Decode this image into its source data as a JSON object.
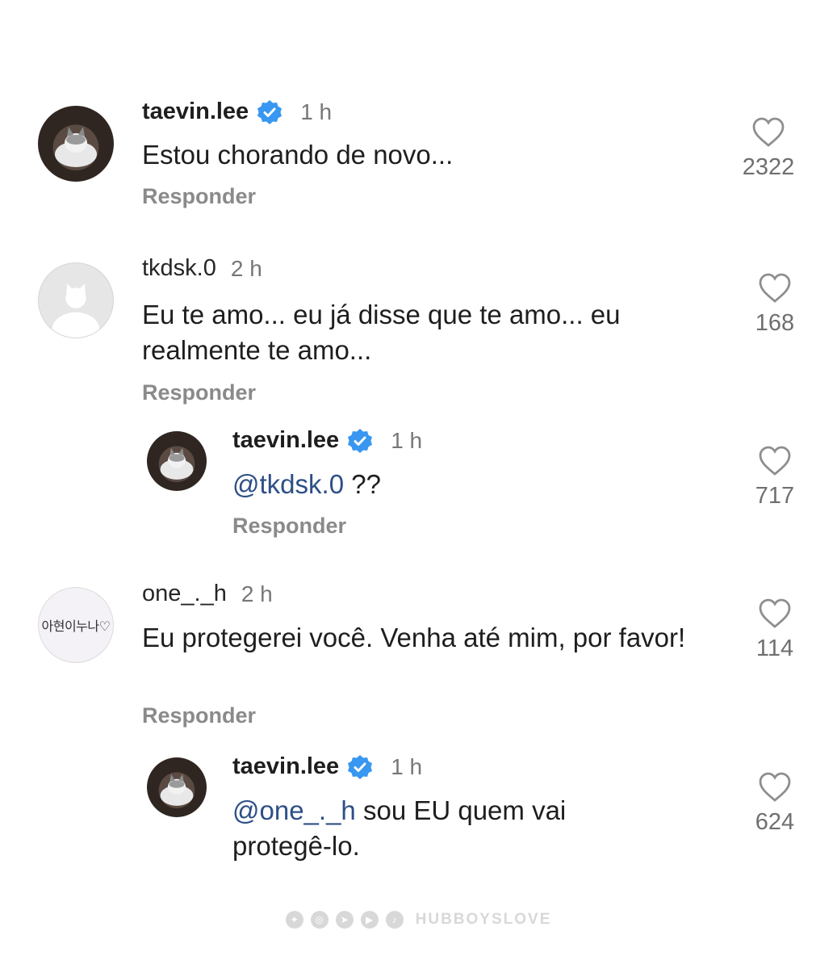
{
  "comments": [
    {
      "username": "taevin.lee",
      "verified": true,
      "time": "1 h",
      "text": "Estou chorando de novo...",
      "reply_label": "Responder",
      "likes": "2322",
      "avatar": "cat-photo"
    },
    {
      "username": "tkdsk.0",
      "verified": false,
      "time": "2 h",
      "text": "Eu te amo... eu já disse que te amo... eu realmente te amo...",
      "reply_label": "Responder",
      "likes": "168",
      "avatar": "default-cat-silhouette",
      "replies": [
        {
          "username": "taevin.lee",
          "verified": true,
          "time": "1 h",
          "mention": "@tkdsk.0",
          "text": " ??",
          "reply_label": "Responder",
          "likes": "717",
          "avatar": "cat-photo"
        }
      ]
    },
    {
      "username": "one_._h",
      "verified": false,
      "time": "2 h",
      "text": "Eu protegerei você. Venha até mim, por favor!",
      "reply_label": "Responder",
      "likes": "114",
      "avatar_text": "아현이누나♡",
      "replies": [
        {
          "username": "taevin.lee",
          "verified": true,
          "time": "1 h",
          "mention": "@one_._h",
          "text": " sou EU quem vai protegê-lo.",
          "likes": "624",
          "avatar": "cat-photo"
        }
      ]
    }
  ],
  "watermark": {
    "text": "HUBBOYSLOVE",
    "icons": [
      "twitter-icon",
      "instagram-icon",
      "telegram-icon",
      "youtube-icon",
      "tiktok-icon"
    ]
  },
  "colors": {
    "verified_badge": "#3897f0",
    "mention": "#2e4f86",
    "secondary_text": "#8a8a8a"
  }
}
